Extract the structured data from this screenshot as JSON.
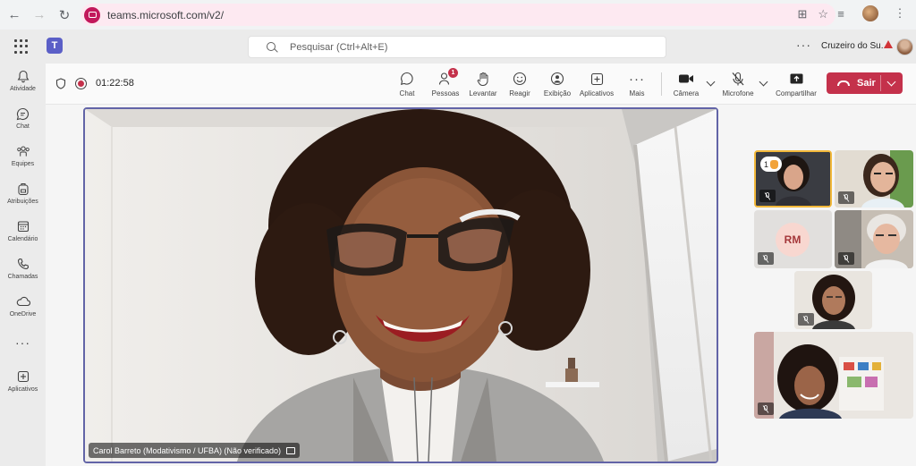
{
  "browser": {
    "url": "teams.microsoft.com/v2/"
  },
  "header": {
    "search_placeholder": "Pesquisar (Ctrl+Alt+E)",
    "more": "···",
    "org_name": "Cruzeiro do Su..."
  },
  "rail": {
    "items": [
      {
        "label": "Atividade",
        "icon": "bell-icon"
      },
      {
        "label": "Chat",
        "icon": "chat-icon"
      },
      {
        "label": "Equipes",
        "icon": "teams-icon"
      },
      {
        "label": "Atribuições",
        "icon": "backpack-icon"
      },
      {
        "label": "Calendário",
        "icon": "calendar-icon"
      },
      {
        "label": "Chamadas",
        "icon": "phone-icon"
      },
      {
        "label": "OneDrive",
        "icon": "cloud-icon"
      },
      {
        "label": "",
        "icon": "more-icon"
      },
      {
        "label": "Aplicativos",
        "icon": "apps-icon"
      }
    ]
  },
  "meeting": {
    "timer": "01:22:58",
    "controls": {
      "chat": "Chat",
      "people": "Pessoas",
      "people_badge": "1",
      "raise": "Levantar",
      "react": "Reagir",
      "view": "Exibição",
      "apps": "Aplicativos",
      "more": "Mais",
      "camera": "Câmera",
      "mic": "Microfone",
      "share": "Compartilhar",
      "leave": "Sair"
    }
  },
  "main_video": {
    "speaker_name": "Carol Barreto (Modativismo / UFBA) (Não verificado)"
  },
  "gallery": {
    "hand_count": "1",
    "initials": "RM"
  },
  "colors": {
    "accent": "#6264a7",
    "leave": "#c4314b",
    "hand_border": "#f2b83a"
  }
}
